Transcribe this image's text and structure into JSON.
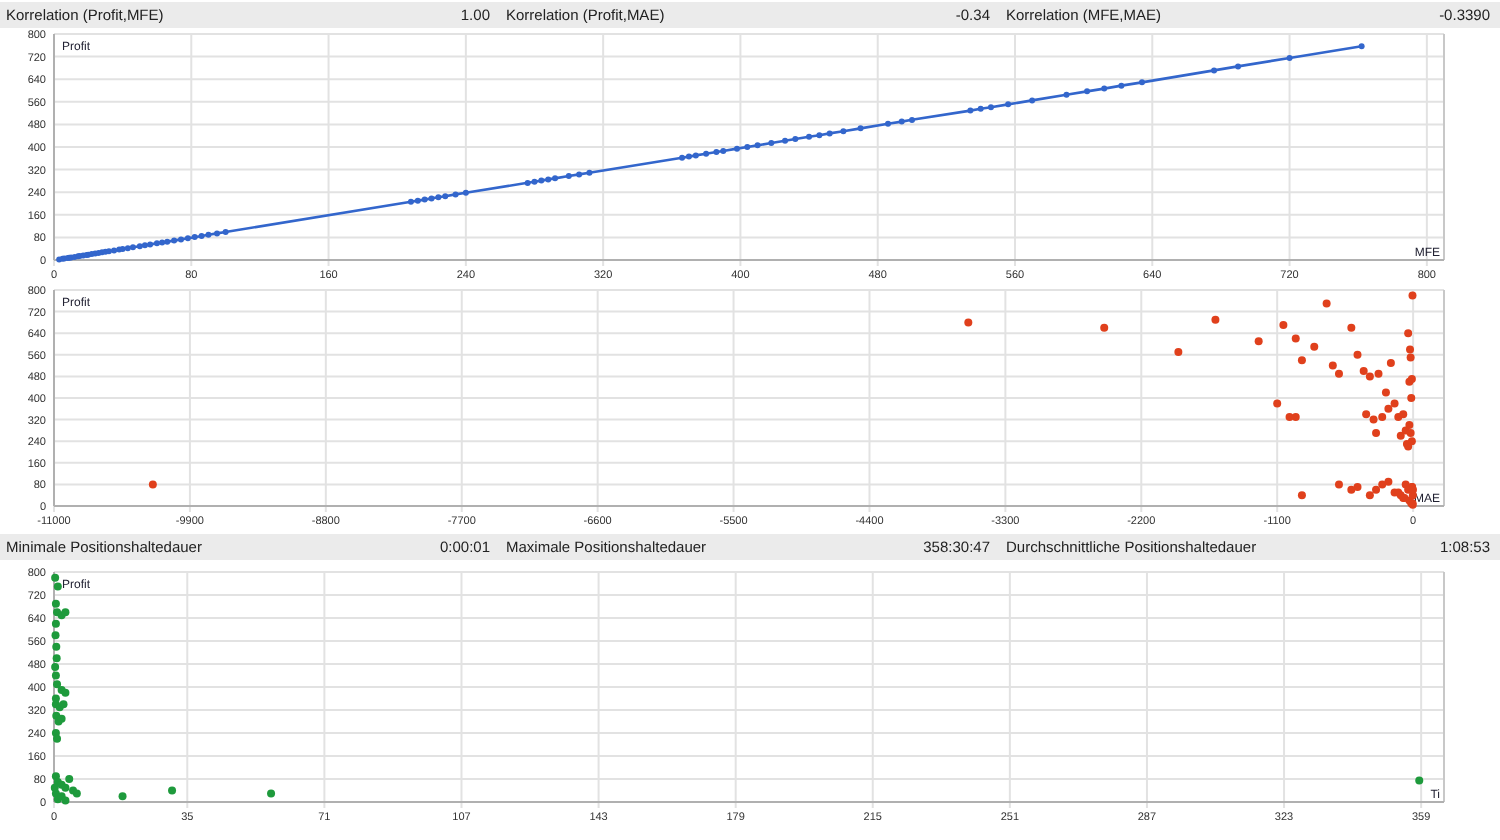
{
  "sections": [
    {
      "kind": "stats",
      "items": [
        {
          "label": "Korrelation (Profit,MFE)",
          "value": "1.00"
        },
        {
          "label": "Korrelation (Profit,MAE)",
          "value": "-0.34"
        },
        {
          "label": "Korrelation (MFE,MAE)",
          "value": "-0.3390"
        }
      ]
    },
    {
      "kind": "chart",
      "chart_data": {
        "type": "line",
        "grid": true,
        "marker": true,
        "xlabel": "MFE",
        "ylabel": "Profit",
        "xlim": [
          0,
          810
        ],
        "ylim": [
          0,
          800
        ],
        "xticks": [
          0,
          80,
          160,
          240,
          320,
          400,
          480,
          560,
          640,
          720,
          800
        ],
        "yticks": [
          0,
          80,
          160,
          240,
          320,
          400,
          480,
          560,
          640,
          720,
          800
        ],
        "x": [
          3,
          5,
          6,
          8,
          9,
          10,
          12,
          14,
          15,
          17,
          19,
          20,
          22,
          24,
          26,
          28,
          30,
          32,
          35,
          38,
          40,
          43,
          46,
          50,
          53,
          56,
          60,
          63,
          66,
          70,
          74,
          78,
          82,
          86,
          90,
          95,
          100,
          208,
          212,
          216,
          220,
          224,
          228,
          234,
          240,
          276,
          280,
          284,
          288,
          292,
          300,
          306,
          312,
          366,
          370,
          374,
          380,
          386,
          390,
          398,
          404,
          410,
          418,
          426,
          432,
          440,
          446,
          452,
          460,
          470,
          486,
          494,
          500,
          534,
          540,
          546,
          556,
          570,
          590,
          602,
          612,
          622,
          634,
          676,
          690,
          720,
          762
        ],
        "series": [
          {
            "color": "#3366cc",
            "values": [
              2,
              4,
              5,
              7,
              8,
              9,
              11,
              13,
              14,
              16,
              18,
              19,
              21,
              23,
              25,
              27,
              29,
              31,
              34,
              37,
              39,
              42,
              45,
              49,
              52,
              55,
              59,
              62,
              65,
              69,
              73,
              77,
              81,
              85,
              89,
              94,
              99,
              206,
              210,
              214,
              218,
              222,
              226,
              232,
              238,
              273,
              277,
              281,
              285,
              289,
              297,
              303,
              309,
              362,
              366,
              370,
              376,
              382,
              386,
              394,
              400,
              406,
              414,
              422,
              428,
              436,
              442,
              448,
              456,
              466,
              482,
              490,
              496,
              529,
              535,
              541,
              551,
              565,
              585,
              597,
              607,
              617,
              629,
              671,
              685,
              715,
              757
            ]
          }
        ]
      }
    },
    {
      "kind": "chart",
      "chart_data": {
        "type": "scatter",
        "grid": true,
        "xlabel": "MAE",
        "ylabel": "Profit",
        "xlim": [
          -11000,
          250
        ],
        "ylim": [
          0,
          800
        ],
        "xticks": [
          -11000,
          -9900,
          -8800,
          -7700,
          -6600,
          -5500,
          -4400,
          -3300,
          -2200,
          -1100,
          0
        ],
        "yticks": [
          0,
          80,
          160,
          240,
          320,
          400,
          480,
          560,
          640,
          720,
          800
        ],
        "x": [
          -10200,
          -3600,
          -2500,
          -1900,
          -1600,
          -1250,
          -1050,
          -950,
          -900,
          -800,
          -700,
          -650,
          -600,
          -500,
          -450,
          -400,
          -380,
          -350,
          -320,
          -300,
          -280,
          -250,
          -220,
          -200,
          -180,
          -150,
          -120,
          -100,
          -80,
          -60,
          -50,
          -40,
          -30,
          -20,
          -10,
          -5,
          -600,
          -450,
          -300,
          -200,
          -150,
          -100,
          -80,
          -60,
          -40,
          -10,
          -5,
          -900,
          -500,
          -350,
          -250,
          -120,
          -70,
          -30,
          -15,
          -8,
          -3,
          -2,
          -1,
          -1100,
          -950,
          -1000,
          -20,
          -15,
          -30,
          -10,
          -40,
          -25
        ],
        "series": [
          {
            "color": "#e0401c",
            "values": [
              80,
              680,
              660,
              570,
              690,
              610,
              670,
              620,
              540,
              590,
              750,
              520,
              490,
              660,
              560,
              500,
              340,
              480,
              320,
              270,
              490,
              330,
              420,
              360,
              530,
              380,
              330,
              260,
              340,
              280,
              230,
              640,
              460,
              550,
              240,
              780,
              80,
              70,
              60,
              90,
              50,
              40,
              30,
              80,
              60,
              70,
              10,
              40,
              60,
              40,
              80,
              50,
              30,
              20,
              10,
              70,
              5,
              40,
              60,
              380,
              330,
              330,
              270,
              400,
              300,
              470,
              220,
              580
            ]
          }
        ]
      }
    },
    {
      "kind": "stats",
      "items": [
        {
          "label": "Minimale Positionshaltedauer",
          "value": "0:00:01"
        },
        {
          "label": "Maximale Positionshaltedauer",
          "value": "358:30:47"
        },
        {
          "label": "Durchschnittliche Positionshaltedauer",
          "value": "1:08:53"
        }
      ]
    },
    {
      "kind": "chart",
      "chart_data": {
        "type": "scatter",
        "grid": true,
        "xlabel": "Ti",
        "ylabel": "Profit",
        "xlim": [
          0,
          365
        ],
        "ylim": [
          0,
          800
        ],
        "xticks": [
          {
            "value": 0,
            "label": "0"
          },
          {
            "value": 35,
            "label": "35"
          },
          {
            "value": 71,
            "label": "71"
          },
          {
            "value": 107,
            "label": "107"
          },
          {
            "value": 143,
            "label": "143"
          },
          {
            "value": 179,
            "label": "179"
          },
          {
            "value": 215,
            "label": "215"
          },
          {
            "value": 251,
            "label": "251"
          },
          {
            "value": 287,
            "label": "287"
          },
          {
            "value": 323,
            "label": "323"
          },
          {
            "value": 359,
            "label": "359"
          }
        ],
        "yticks": [
          0,
          80,
          160,
          240,
          320,
          400,
          480,
          560,
          640,
          720,
          800
        ],
        "x": [
          0.3,
          1,
          0.5,
          0.8,
          2,
          3,
          0.5,
          0.4,
          0.6,
          0.7,
          0.3,
          0.5,
          0.8,
          2,
          3,
          0.5,
          1.5,
          2.5,
          0.6,
          1.2,
          2,
          0.5,
          0.8,
          0.5,
          1,
          2,
          3,
          4,
          5,
          6,
          0.5,
          1,
          2,
          3,
          0.2,
          18,
          31,
          57,
          0.5,
          358.5
        ],
        "series": [
          {
            "color": "#1e9a3c",
            "values": [
              780,
              750,
              690,
              660,
              650,
              660,
              620,
              580,
              540,
              500,
              470,
              440,
              410,
              390,
              380,
              340,
              330,
              340,
              300,
              280,
              290,
              240,
              220,
              90,
              70,
              60,
              50,
              80,
              40,
              30,
              30,
              10,
              20,
              5,
              50,
              20,
              40,
              30,
              360,
              75
            ]
          }
        ]
      }
    }
  ]
}
